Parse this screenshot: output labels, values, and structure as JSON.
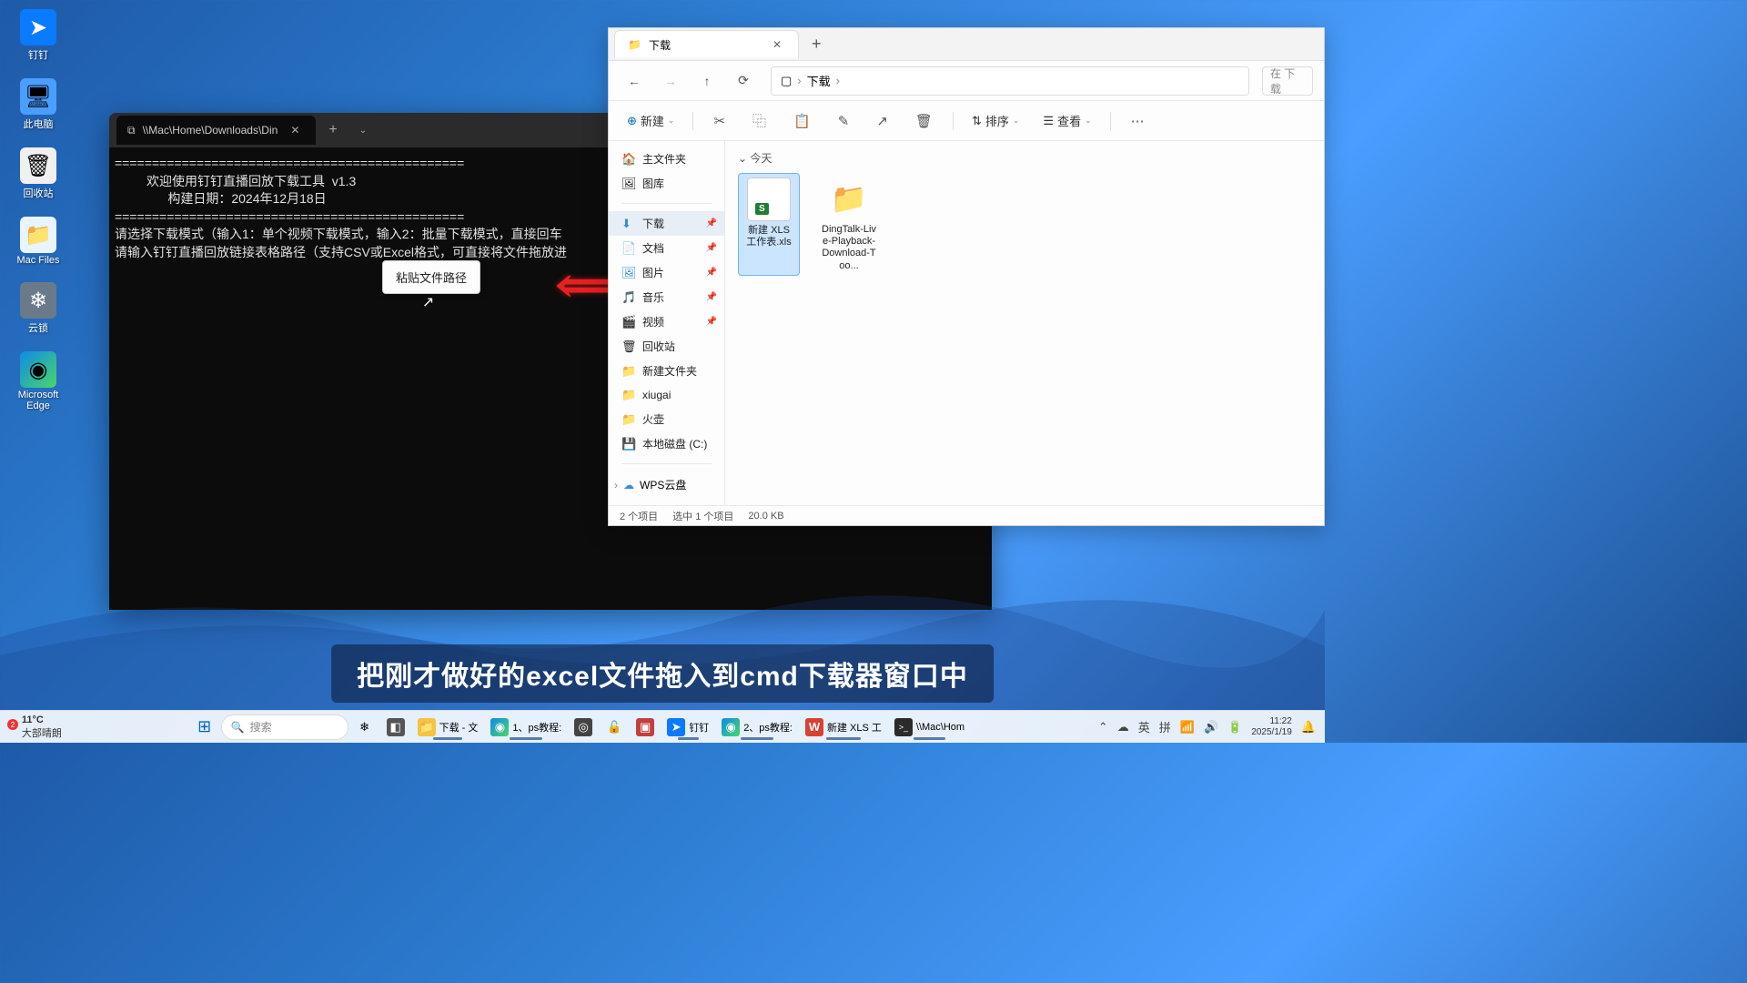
{
  "desktop": {
    "icons": [
      {
        "name": "dingtalk",
        "label": "钉钉",
        "glyph": "➤",
        "cls": "icon-blue"
      },
      {
        "name": "this-pc",
        "label": "此电脑",
        "glyph": "🖥",
        "cls": "icon-monitor"
      },
      {
        "name": "recycle-bin",
        "label": "回收站",
        "glyph": "🗑",
        "cls": "icon-recycle"
      },
      {
        "name": "mac-files",
        "label": "Mac Files",
        "glyph": "📁",
        "cls": "icon-mac"
      },
      {
        "name": "yunsuo",
        "label": "云锁",
        "glyph": "❄",
        "cls": "icon-gray"
      },
      {
        "name": "edge",
        "label": "Microsoft Edge",
        "glyph": "◉",
        "cls": "icon-edge"
      }
    ]
  },
  "terminal": {
    "tab_title": "\\\\Mac\\Home\\Downloads\\Din",
    "divider": "===============================================",
    "title_line": "欢迎使用钉钉直播回放下载工具  v1.3",
    "build_line": "构建日期：2024年12月18日",
    "prompt1": "请选择下载模式（输入1：单个视频下载模式，输入2：批量下载模式，直接回车",
    "prompt2": "请输入钉钉直播回放链接表格路径（支持CSV或Excel格式，可直接将文件拖放进"
  },
  "context_menu": {
    "paste_path": "粘贴文件路径"
  },
  "explorer": {
    "tab_title": "下载",
    "breadcrumb": "下载",
    "search_placeholder": "在 下载",
    "toolbar": {
      "new": "新建",
      "sort": "排序",
      "view": "查看"
    },
    "sidebar": {
      "home": "主文件夹",
      "gallery": "图库",
      "downloads": "下载",
      "documents": "文档",
      "pictures": "图片",
      "music": "音乐",
      "videos": "视频",
      "recycle": "回收站",
      "new_folder": "新建文件夹",
      "xiugai": "xiugai",
      "huohu": "火壶",
      "local_c": "本地磁盘 (C:)",
      "wps": "WPS云盘"
    },
    "files": {
      "group_today": "今天",
      "xls_name": "新建 XLS 工作表.xls",
      "folder_name": "DingTalk-Live-Playback-Download-Too..."
    },
    "status": {
      "items": "2 个项目",
      "selected": "选中 1 个项目",
      "size": "20.0 KB"
    }
  },
  "subtitle": "把刚才做好的excel文件拖入到cmd下载器窗口中",
  "taskbar": {
    "weather_temp": "11°C",
    "weather_text": "大部晴朗",
    "weather_badge": "2",
    "search": "搜索",
    "items": [
      {
        "name": "explorer",
        "label": "下载 - 文",
        "glyph": "📁",
        "bg": "#f5c242"
      },
      {
        "name": "edge1",
        "label": "1、ps教程:",
        "glyph": "◉",
        "bg": "#0c8ce9"
      },
      {
        "name": "app1",
        "label": "",
        "glyph": "◎",
        "bg": "#444"
      },
      {
        "name": "lock",
        "label": "",
        "glyph": "🔒",
        "bg": "#d4a84a"
      },
      {
        "name": "app2",
        "label": "",
        "glyph": "▣",
        "bg": "#c04040"
      },
      {
        "name": "dingtalk",
        "label": "钉钉",
        "glyph": "➤",
        "bg": "#0a7aff"
      },
      {
        "name": "edge2",
        "label": "2、ps教程:",
        "glyph": "◉",
        "bg": "#0c8ce9"
      },
      {
        "name": "wps",
        "label": "新建 XLS 工",
        "glyph": "W",
        "bg": "#d84030"
      },
      {
        "name": "terminal",
        "label": "\\\\Mac\\Hom",
        "glyph": ">_",
        "bg": "#2b2b2b"
      }
    ],
    "ime1": "英",
    "ime2": "拼",
    "time": "11:22",
    "date": "2025/1/19"
  }
}
